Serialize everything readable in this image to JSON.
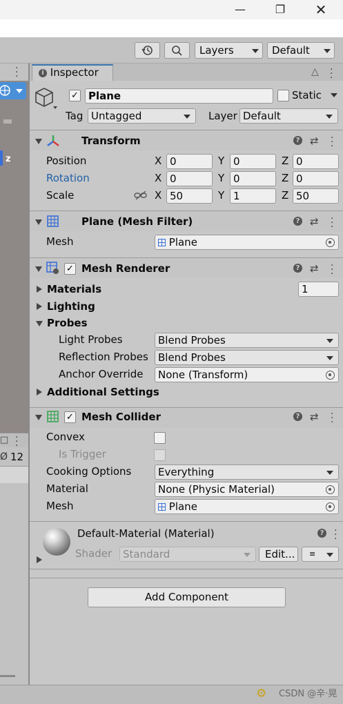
{
  "toolbar": {
    "layers_label": "Layers",
    "layout_label": "Default"
  },
  "left_panel": {
    "axis_label": "z",
    "count_label": "12"
  },
  "inspector": {
    "tab_label": "Inspector",
    "object": {
      "name": "Plane",
      "active": true,
      "static_label": "Static",
      "tag_label": "Tag",
      "tag_value": "Untagged",
      "layer_label": "Layer",
      "layer_value": "Default"
    },
    "transform": {
      "title": "Transform",
      "position_label": "Position",
      "rotation_label": "Rotation",
      "scale_label": "Scale",
      "x_label": "X",
      "y_label": "Y",
      "z_label": "Z",
      "position": {
        "x": "0",
        "y": "0",
        "z": "0"
      },
      "rotation": {
        "x": "0",
        "y": "0",
        "z": "0"
      },
      "scale": {
        "x": "50",
        "y": "1",
        "z": "50"
      }
    },
    "mesh_filter": {
      "title": "Plane (Mesh Filter)",
      "mesh_label": "Mesh",
      "mesh_value": "Plane"
    },
    "mesh_renderer": {
      "title": "Mesh Renderer",
      "enabled": true,
      "materials_label": "Materials",
      "materials_count": "1",
      "lighting_label": "Lighting",
      "probes_label": "Probes",
      "light_probes_label": "Light Probes",
      "light_probes_value": "Blend Probes",
      "reflection_probes_label": "Reflection Probes",
      "reflection_probes_value": "Blend Probes",
      "anchor_override_label": "Anchor Override",
      "anchor_override_value": "None (Transform)",
      "additional_settings_label": "Additional Settings"
    },
    "mesh_collider": {
      "title": "Mesh Collider",
      "enabled": true,
      "convex_label": "Convex",
      "is_trigger_label": "Is Trigger",
      "cooking_options_label": "Cooking Options",
      "cooking_options_value": "Everything",
      "material_label": "Material",
      "material_value": "None (Physic Material)",
      "mesh_label": "Mesh",
      "mesh_value": "Plane"
    },
    "material": {
      "title": "Default-Material (Material)",
      "shader_label": "Shader",
      "shader_value": "Standard",
      "edit_label": "Edit..."
    },
    "add_component_label": "Add Component"
  },
  "statusbar": {
    "watermark": "CSDN @辛·晃"
  },
  "colors": {
    "accent_blue": "#2160a8",
    "panel_bg": "#c8c8c8",
    "scene_bg": "#8e8886"
  }
}
